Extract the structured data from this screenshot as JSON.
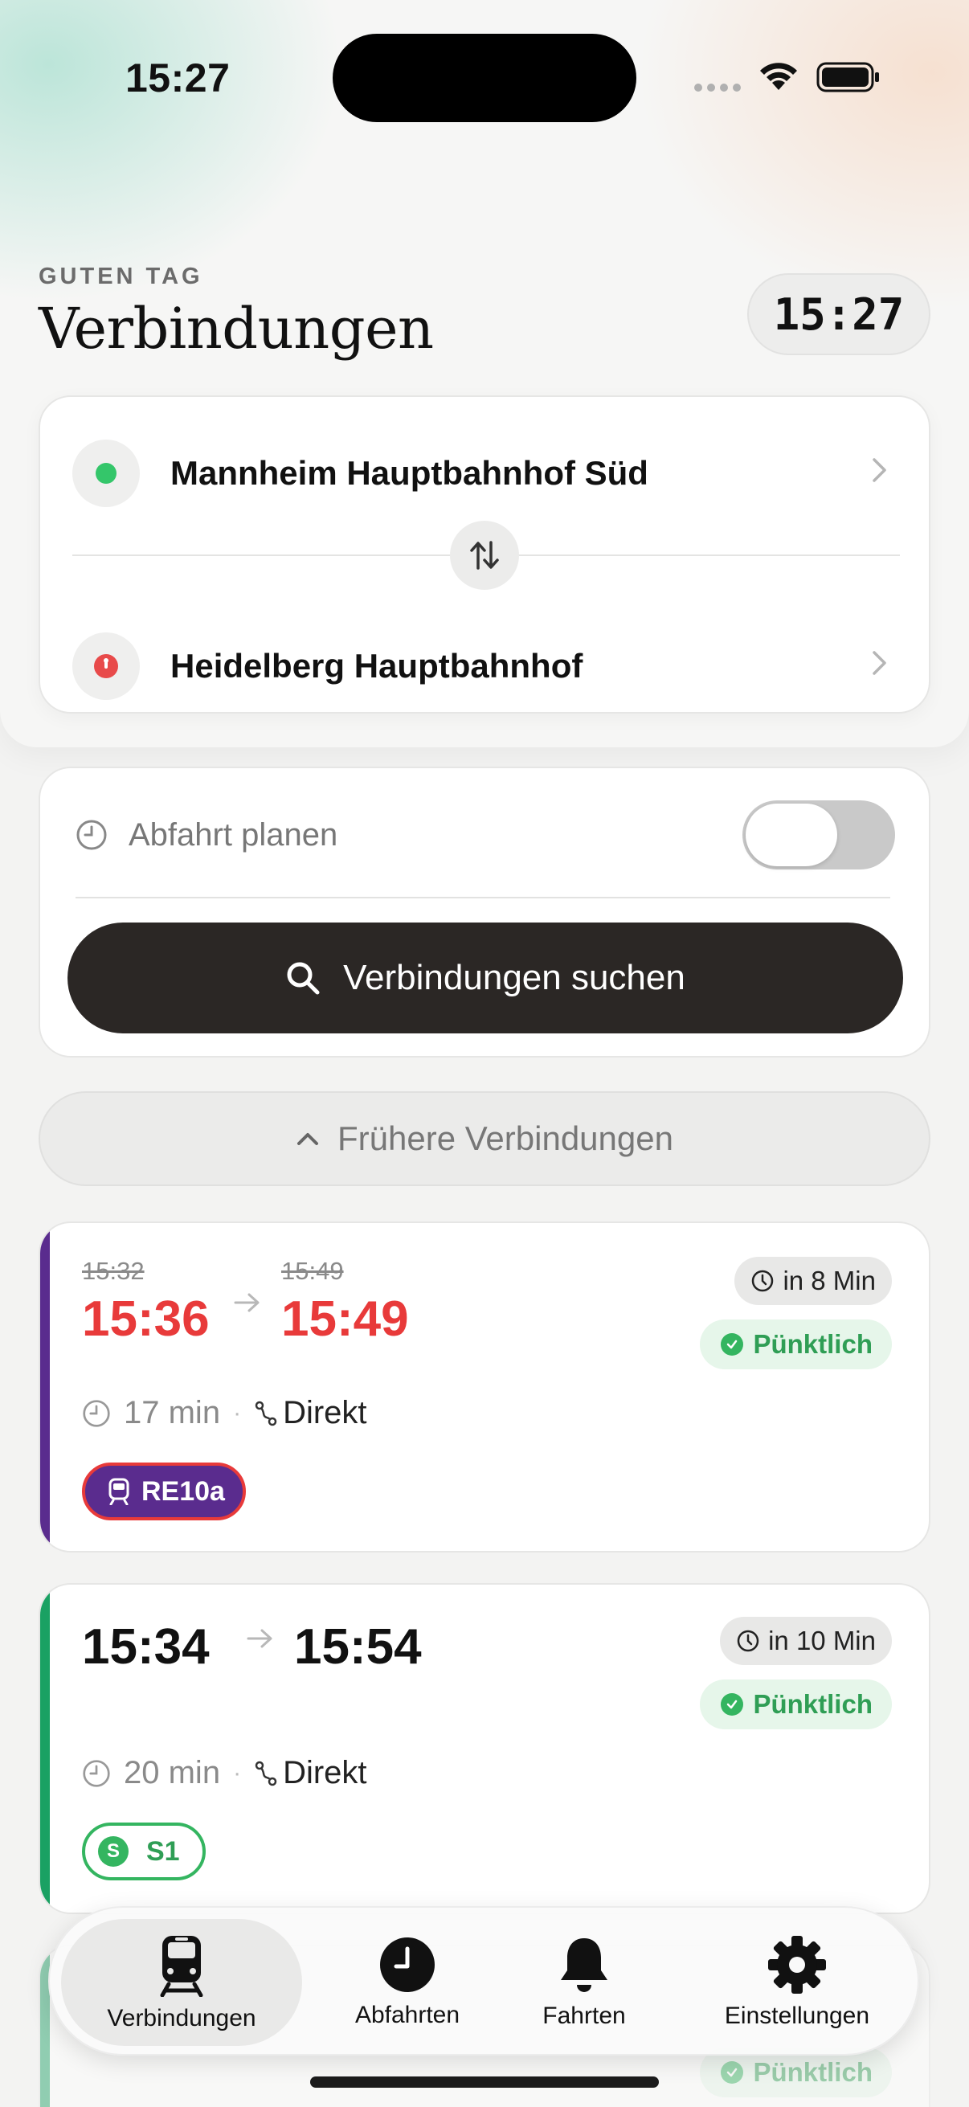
{
  "status_bar": {
    "time": "15:27"
  },
  "header": {
    "greeting": "GUTEN TAG",
    "title": "Verbindungen",
    "clock": "15:27"
  },
  "route": {
    "origin": "Mannheim Hauptbahnhof Süd",
    "destination": "Heidelberg Hauptbahnhof",
    "origin_color": "#34c66a",
    "destination_color": "#e84a4a"
  },
  "search": {
    "plan_label": "Abfahrt planen",
    "plan_toggle_on": false,
    "button_label": "Verbindungen suchen"
  },
  "earlier_label": "Frühere Verbindungen",
  "connections": [
    {
      "scheduled_departure": "15:32",
      "scheduled_arrival": "15:49",
      "departure": "15:36",
      "arrival": "15:49",
      "delayed": true,
      "eta": "in 8 Min",
      "status": "Pünktlich",
      "duration": "17 min",
      "transfers": "Direkt",
      "line": "RE10a",
      "line_color": "#5a2c8e"
    },
    {
      "departure": "15:34",
      "arrival": "15:54",
      "delayed": false,
      "eta": "in 10 Min",
      "status": "Pünktlich",
      "duration": "20 min",
      "transfers": "Direkt",
      "line": "S1",
      "line_prefix": "S",
      "line_color": "#34b560"
    },
    {
      "status": "Pünktlich"
    }
  ],
  "tabs": [
    {
      "label": "Verbindungen",
      "icon": "train-icon",
      "active": true
    },
    {
      "label": "Abfahrten",
      "icon": "clock-icon",
      "active": false
    },
    {
      "label": "Fahrten",
      "icon": "bell-icon",
      "active": false
    },
    {
      "label": "Einstellungen",
      "icon": "gear-icon",
      "active": false
    }
  ]
}
